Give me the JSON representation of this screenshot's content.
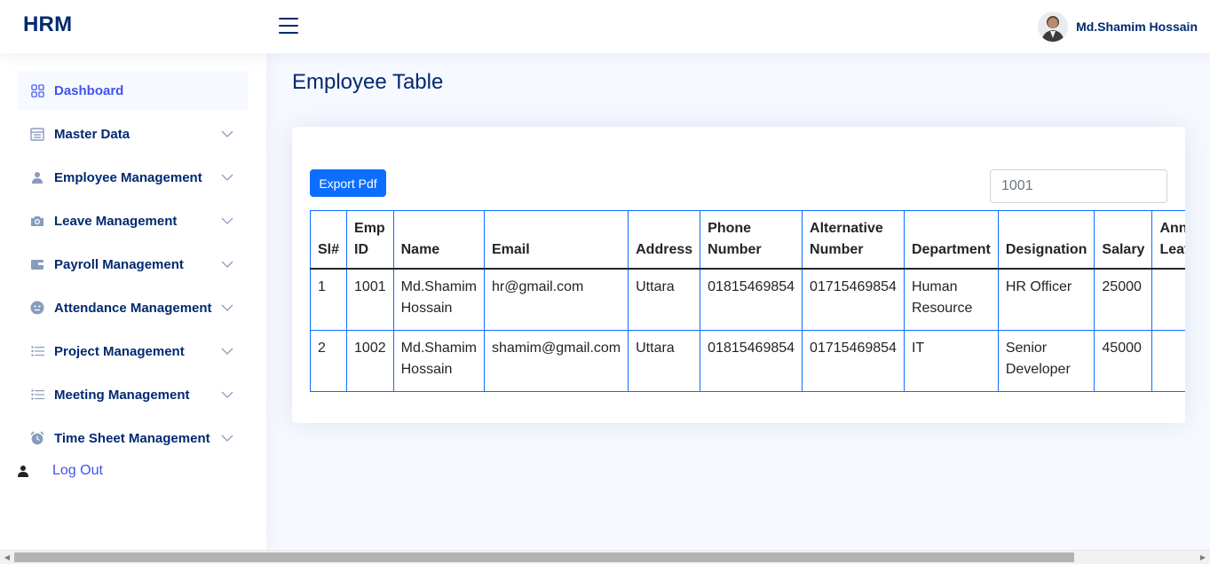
{
  "app": {
    "logo": "HRM"
  },
  "header": {
    "user_name": "Md.Shamim Hossain"
  },
  "sidebar": {
    "items": [
      {
        "label": "Dashboard",
        "icon": "grid-icon",
        "active": true
      },
      {
        "label": "Master Data",
        "icon": "menu-list-icon"
      },
      {
        "label": "Employee Management",
        "icon": "person-icon"
      },
      {
        "label": "Leave Management",
        "icon": "camera-icon"
      },
      {
        "label": "Payroll Management",
        "icon": "wallet-icon"
      },
      {
        "label": "Attendance Management",
        "icon": "emoji-icon"
      },
      {
        "label": "Project Management",
        "icon": "list-icon"
      },
      {
        "label": "Meeting Management",
        "icon": "list-icon"
      },
      {
        "label": "Time Sheet Management",
        "icon": "alarm-icon"
      }
    ],
    "logout_label": "Log Out"
  },
  "main": {
    "title": "Employee Table",
    "export_label": "Export Pdf",
    "search_value": "1001"
  },
  "table": {
    "headers": [
      "Sl#",
      "Emp ID",
      "Name",
      "Email",
      "Address",
      "Phone Number",
      "Alternative Number",
      "Department",
      "Designation",
      "Salary",
      "Annual Leave"
    ],
    "rows": [
      [
        "1",
        "1001",
        "Md.Shamim Hossain",
        "hr@gmail.com",
        "Uttara",
        "01815469854",
        "01715469854",
        "Human Resource",
        "HR Officer",
        "25000",
        ""
      ],
      [
        "2",
        "1002",
        "Md.Shamim Hossain",
        "shamim@gmail.com",
        "Uttara",
        "01815469854",
        "01715469854",
        "IT",
        "Senior Developer",
        "45000",
        ""
      ]
    ]
  },
  "colors": {
    "primary": "#4154f1",
    "navy": "#012970",
    "button": "#0d6efd"
  }
}
